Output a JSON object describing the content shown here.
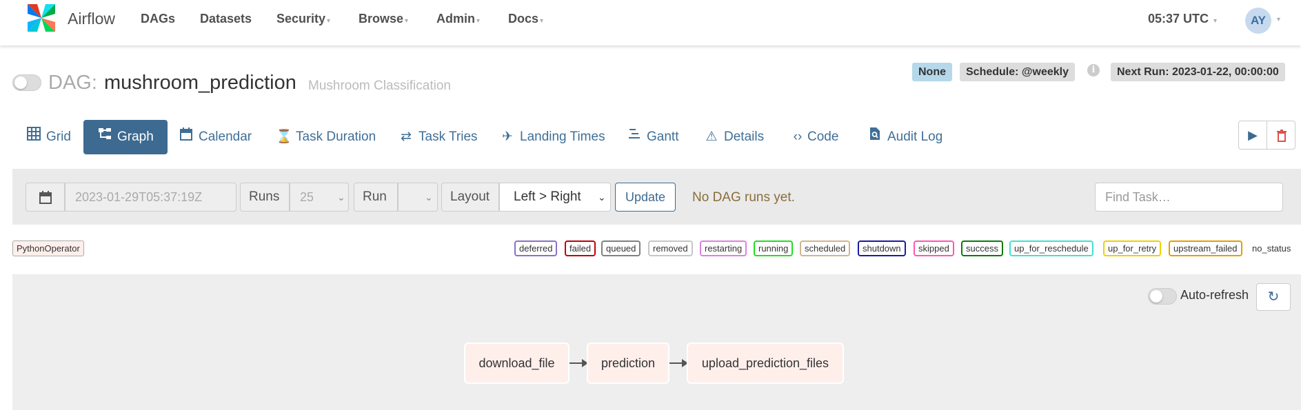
{
  "navbar": {
    "brand": "Airflow",
    "items": [
      {
        "label": "DAGs",
        "dropdown": false
      },
      {
        "label": "Datasets",
        "dropdown": false
      },
      {
        "label": "Security",
        "dropdown": true
      },
      {
        "label": "Browse",
        "dropdown": true
      },
      {
        "label": "Admin",
        "dropdown": true
      },
      {
        "label": "Docs",
        "dropdown": true
      }
    ],
    "clock": "05:37 UTC",
    "avatar": "AY"
  },
  "dag": {
    "prefix": "DAG:",
    "id": "mushroom_prediction",
    "description": "Mushroom Classification",
    "paused": true,
    "badges": {
      "owner": "None",
      "schedule": "Schedule: @weekly",
      "next_run": "Next Run: 2023-01-22, 00:00:00"
    }
  },
  "tabs": [
    {
      "label": "Grid",
      "icon": "grid-icon",
      "active": false
    },
    {
      "label": "Graph",
      "icon": "graph-icon",
      "active": true
    },
    {
      "label": "Calendar",
      "icon": "calendar-icon",
      "active": false
    },
    {
      "label": "Task Duration",
      "icon": "hourglass-icon",
      "active": false
    },
    {
      "label": "Task Tries",
      "icon": "retry-icon",
      "active": false
    },
    {
      "label": "Landing Times",
      "icon": "plane-landing-icon",
      "active": false
    },
    {
      "label": "Gantt",
      "icon": "gantt-icon",
      "active": false
    },
    {
      "label": "Details",
      "icon": "warning-triangle-icon",
      "active": false
    },
    {
      "label": "Code",
      "icon": "code-icon",
      "active": false
    },
    {
      "label": "Audit Log",
      "icon": "file-search-icon",
      "active": false
    }
  ],
  "filters": {
    "date_value": "2023-01-29T05:37:19Z",
    "runs_label": "Runs",
    "runs_value": "25",
    "run_label": "Run",
    "run_value": "",
    "layout_label": "Layout",
    "layout_value": "Left > Right",
    "update_label": "Update",
    "status_message": "No DAG runs yet.",
    "find_placeholder": "Find Task…"
  },
  "legend": {
    "operator": "PythonOperator",
    "states": [
      {
        "name": "deferred",
        "color": "#8a6fc8"
      },
      {
        "name": "failed",
        "color": "#c0000a"
      },
      {
        "name": "queued",
        "color": "#808080"
      },
      {
        "name": "removed",
        "color": "#c6c6c6"
      },
      {
        "name": "restarting",
        "color": "#de80de"
      },
      {
        "name": "running",
        "color": "#22dd22"
      },
      {
        "name": "scheduled",
        "color": "#d2b48c"
      },
      {
        "name": "shutdown",
        "color": "#1a1aa0"
      },
      {
        "name": "skipped",
        "color": "#ff56b0"
      },
      {
        "name": "success",
        "color": "#0b7a0b"
      },
      {
        "name": "up_for_reschedule",
        "color": "#40e0d0"
      },
      {
        "name": "up_for_retry",
        "color": "#f0d000"
      },
      {
        "name": "upstream_failed",
        "color": "#e69d00"
      }
    ],
    "no_status": "no_status"
  },
  "graph": {
    "auto_refresh_label": "Auto-refresh",
    "tasks": [
      "download_file",
      "prediction",
      "upload_prediction_files"
    ]
  }
}
